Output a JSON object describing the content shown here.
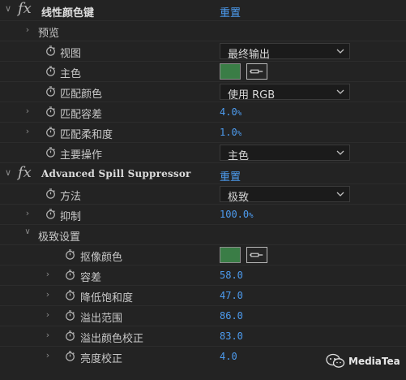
{
  "effect1": {
    "title": "线性颜色键",
    "reset_label": "重置",
    "preview_label": "预览",
    "view": {
      "label": "视图",
      "value": "最终输出"
    },
    "key_color": {
      "label": "主色",
      "color": "#3a7d46"
    },
    "match_colors": {
      "label": "匹配颜色",
      "value": "使用 RGB"
    },
    "matching_tolerance": {
      "label": "匹配容差",
      "value": "4.0",
      "unit": "%"
    },
    "matching_softness": {
      "label": "匹配柔和度",
      "value": "1.0",
      "unit": "%"
    },
    "key_operation": {
      "label": "主要操作",
      "value": "主色"
    }
  },
  "effect2": {
    "title": "Advanced Spill Suppressor",
    "reset_label": "重置",
    "method": {
      "label": "方法",
      "value": "极致"
    },
    "suppression": {
      "label": "抑制",
      "value": "100.0",
      "unit": "%"
    },
    "ultra_settings": {
      "label": "极致设置",
      "key_color": {
        "label": "抠像颜色",
        "color": "#3a7d46"
      },
      "tolerance": {
        "label": "容差",
        "value": "58.0"
      },
      "desaturation": {
        "label": "降低饱和度",
        "value": "47.0"
      },
      "spill_range": {
        "label": "溢出范围",
        "value": "86.0"
      },
      "spill_color_correction": {
        "label": "溢出颜色校正",
        "value": "83.0"
      },
      "luma_correction": {
        "label": "亮度校正",
        "value": "4.0"
      }
    }
  },
  "watermark": {
    "text": "MediaTea"
  },
  "colors": {
    "accent": "#4d9cf0",
    "background": "#232323",
    "swatch_green": "#3a7d46"
  }
}
